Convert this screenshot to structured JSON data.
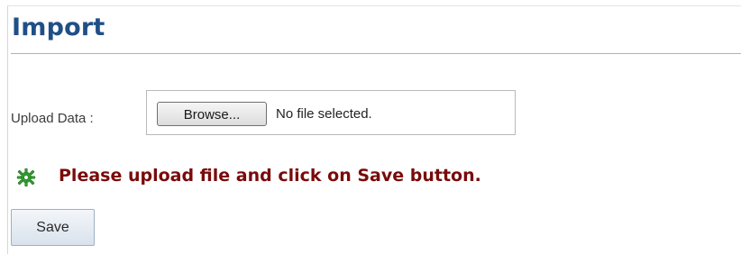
{
  "page": {
    "title": "Import"
  },
  "upload": {
    "label": "Upload Data :",
    "browse_label": "Browse...",
    "file_status": "No file selected."
  },
  "message": {
    "icon": "gear-icon",
    "text": "Please upload file and click on Save button.",
    "color": "#7a0a0a"
  },
  "actions": {
    "save_label": "Save"
  },
  "colors": {
    "title": "#1f4f86",
    "rule": "#a3b4c8",
    "icon": "#2d9c2d"
  }
}
